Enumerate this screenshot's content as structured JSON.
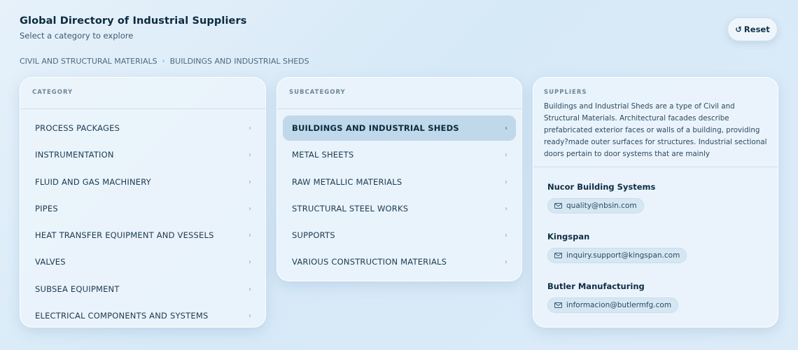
{
  "header": {
    "title": "Global Directory of Industrial Suppliers",
    "subtitle": "Select a category to explore"
  },
  "reset": {
    "icon": "refresh-icon",
    "icon_glyph": "↺",
    "label": "Reset"
  },
  "breadcrumb": {
    "items": [
      "CIVIL AND STRUCTURAL MATERIALS",
      "BUILDINGS AND INDUSTRIAL SHEDS"
    ],
    "separator": "›"
  },
  "category": {
    "label": "CATEGORY",
    "items": [
      "PROCESS PACKAGES",
      "INSTRUMENTATION",
      "FLUID AND GAS MACHINERY",
      "PIPES",
      "HEAT TRANSFER EQUIPMENT AND VESSELS",
      "VALVES",
      "SUBSEA EQUIPMENT",
      "ELECTRICAL COMPONENTS AND SYSTEMS"
    ]
  },
  "subcategory": {
    "label": "SUBCATEGORY",
    "selected": "BUILDINGS AND INDUSTRIAL SHEDS",
    "items": [
      "BUILDINGS AND INDUSTRIAL SHEDS",
      "METAL SHEETS",
      "RAW METALLIC MATERIALS",
      "STRUCTURAL STEEL WORKS",
      "SUPPORTS",
      "VARIOUS CONSTRUCTION MATERIALS"
    ]
  },
  "chevron": "›",
  "suppliers": {
    "label": "SUPPLIERS",
    "description": "Buildings and Industrial Sheds are a type of Civil and Structural Materials. Architectural facades describe prefabricated exterior faces or walls of a building, providing ready?made outer surfaces for structures. Industrial sectional doors pertain to door systems that are mainly",
    "list": [
      {
        "name": "Nucor Building Systems",
        "email": "quality@nbsin.com"
      },
      {
        "name": "Kingspan",
        "email": "inquiry.support@kingspan.com"
      },
      {
        "name": "Butler Manufacturing",
        "email": "informacion@butlermfg.com"
      }
    ]
  },
  "colors": {
    "accent_selected": "#bfd8ea",
    "title_text": "#0c2a40",
    "background": "#dcebf8"
  }
}
